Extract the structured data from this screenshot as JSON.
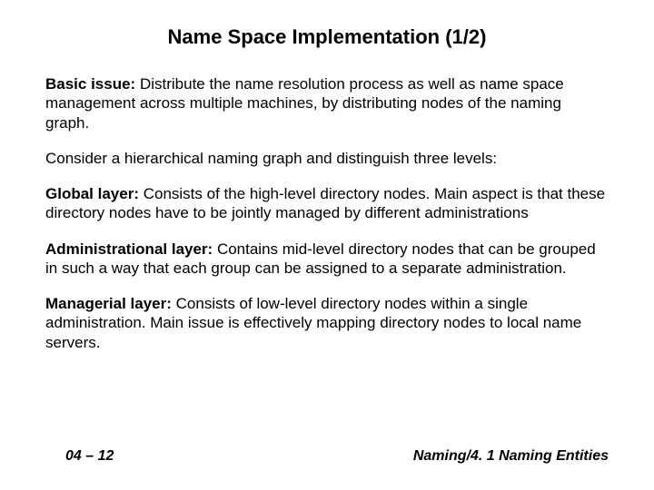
{
  "title": "Name Space Implementation (1/2)",
  "paragraphs": {
    "basic_issue": {
      "lead": "Basic issue:",
      "text": " Distribute the name resolution process as well as name space management across multiple machines, by distributing nodes of the naming graph."
    },
    "consider": {
      "text": "Consider a hierarchical naming graph and distinguish three levels:"
    },
    "global": {
      "lead": "Global layer:",
      "text": " Consists of the high-level directory nodes. Main aspect is that these directory nodes have to be jointly managed by different administrations"
    },
    "admin": {
      "lead": "Administrational layer:",
      "text": " Contains mid-level directory nodes that can be grouped in such a way that each group can be assigned to a separate administration."
    },
    "managerial": {
      "lead": "Managerial layer:",
      "text": " Consists of low-level directory nodes within a single administration. Main issue is effectively mapping directory nodes to local name servers."
    }
  },
  "footer": {
    "left": "04 – 12",
    "right": "Naming/4. 1 Naming Entities"
  }
}
